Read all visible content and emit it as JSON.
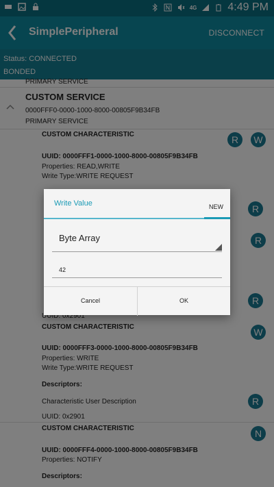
{
  "status_bar": {
    "time": "4:49 PM",
    "network": "4G",
    "icons": [
      "signal-icon",
      "image-icon",
      "lock-icon",
      "bluetooth-icon",
      "nfc-icon",
      "mute-icon",
      "wifi-icon",
      "battery-icon"
    ]
  },
  "app_bar": {
    "title": "SimplePeripheral",
    "action": "DISCONNECT"
  },
  "connection": {
    "status": "Status: CONNECTED",
    "bond": "BONDED"
  },
  "content": {
    "prev_service_type": "PRIMARY SERVICE",
    "service": {
      "name": "CUSTOM SERVICE",
      "uuid": "0000FFF0-0000-1000-8000-00805F9B34FB",
      "type": "PRIMARY SERVICE"
    },
    "characteristics": [
      {
        "name": "CUSTOM CHARACTERISTIC",
        "uuid": "UUID: 0000FFF1-0000-1000-8000-00805F9B34FB",
        "properties": "Properties: READ,WRITE",
        "write_type": "Write Type:WRITE REQUEST",
        "buttons": [
          "R",
          "W"
        ]
      },
      {
        "name": "CUSTOM CHARACTERISTIC",
        "uuid": "UUID: 0000FFF3-0000-1000-8000-00805F9B34FB",
        "properties": "Properties: WRITE",
        "write_type": "Write Type:WRITE REQUEST",
        "buttons": [
          "W"
        ],
        "descriptors_label": "Descriptors:",
        "descriptor": "Characteristic User Description",
        "descriptor_uuid": "UUID: 0x2901",
        "descriptor_button": "R"
      },
      {
        "name": "CUSTOM CHARACTERISTIC",
        "uuid": "UUID: 0000FFF4-0000-1000-8000-00805F9B34FB",
        "properties": "Properties: NOTIFY",
        "buttons": [
          "N"
        ],
        "descriptors_label": "Descriptors:"
      }
    ],
    "partial_uuid": "UUID: 0x2901",
    "obscured_buttons": [
      "R",
      "R",
      "R"
    ]
  },
  "dialog": {
    "title": "Write Value",
    "tab": "NEW",
    "format": "Byte Array",
    "value": "42",
    "cancel": "Cancel",
    "ok": "OK"
  },
  "colors": {
    "status_bar": "#0b6e80",
    "app_bar": "#0f8aa0",
    "accent": "#1a9ab5",
    "action_circle": "#1a7a93"
  }
}
